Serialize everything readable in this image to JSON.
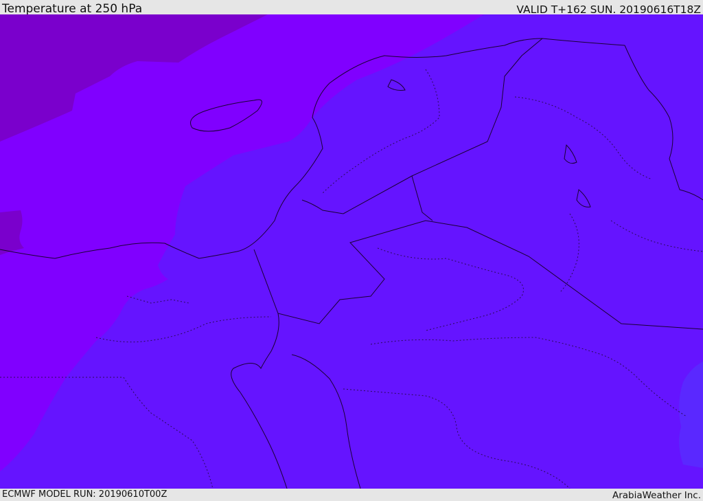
{
  "header": {
    "title": "Temperature at 250 hPa",
    "valid_time": "VALID T+162 SUN. 20190616T18Z"
  },
  "footer": {
    "model_run": "ECMWF MODEL RUN: 20190610T00Z",
    "provider": "ArabiaWeather Inc."
  },
  "colors": {
    "background": "#e6e6e6",
    "temp_band_coldest": "#7a00cc",
    "temp_band_cold": "#8000ff",
    "temp_band_mid": "#6514ff",
    "temp_band_warm": "#5a28ff",
    "coastline": "#1a0033",
    "border_dotted": "#2a0a55"
  }
}
